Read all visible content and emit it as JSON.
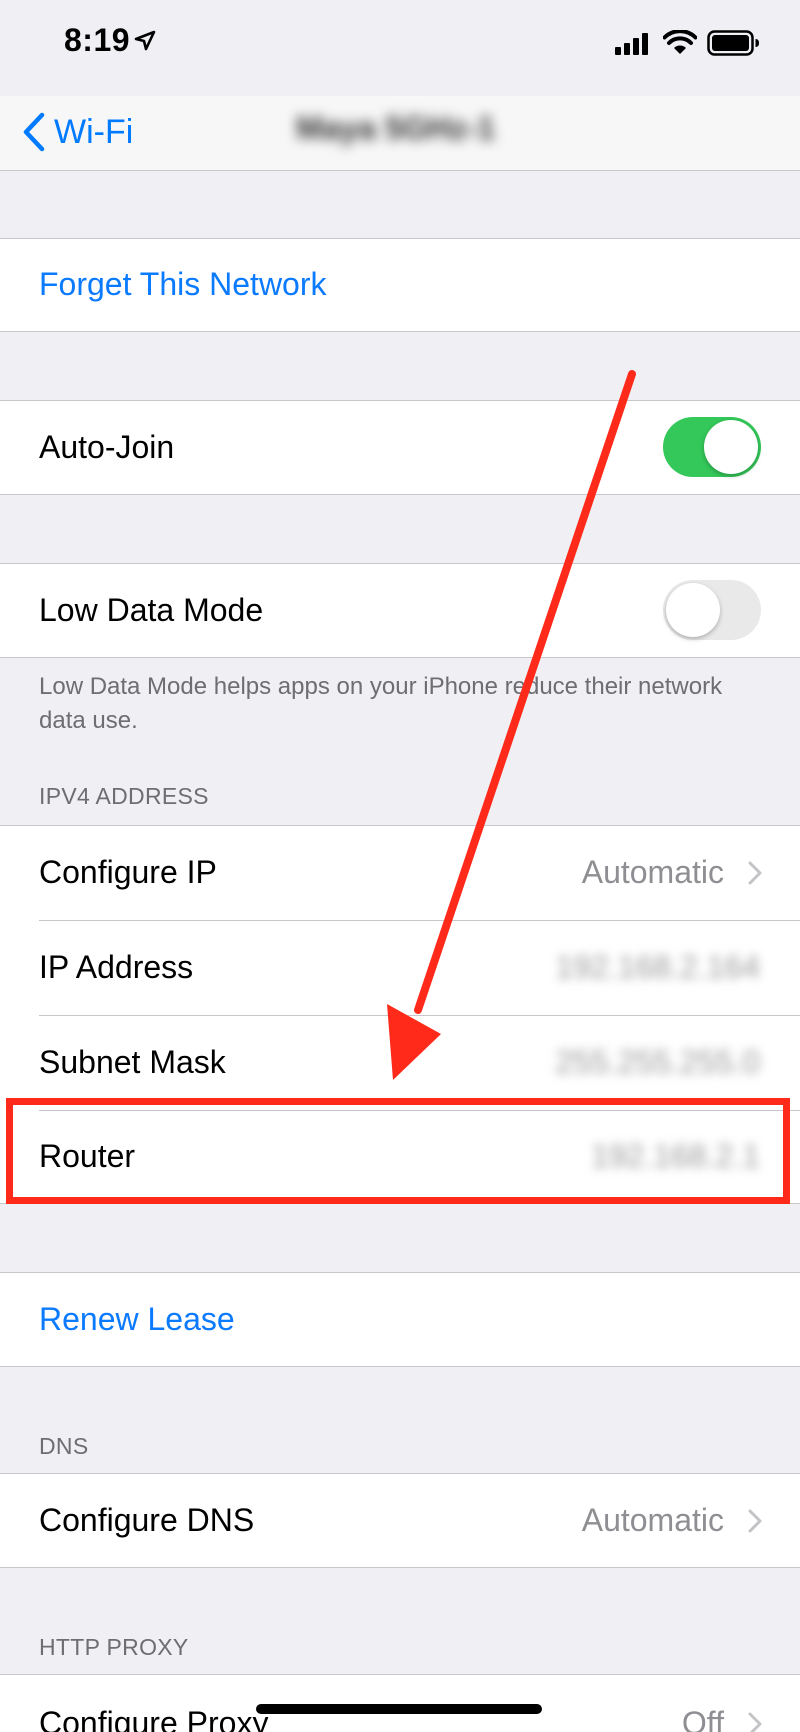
{
  "status_bar": {
    "time": "8:19"
  },
  "nav": {
    "back_label": "Wi-Fi",
    "title": "Maya 5GHz-1"
  },
  "forget_network": {
    "label": "Forget This Network"
  },
  "auto_join": {
    "label": "Auto-Join",
    "enabled": true
  },
  "low_data_mode": {
    "label": "Low Data Mode",
    "enabled": false,
    "footer": "Low Data Mode helps apps on your iPhone reduce their network data use."
  },
  "ipv4": {
    "header": "IPV4 ADDRESS",
    "configure_ip": {
      "label": "Configure IP",
      "value": "Automatic"
    },
    "ip_address": {
      "label": "IP Address",
      "value": "192.168.2.164"
    },
    "subnet_mask": {
      "label": "Subnet Mask",
      "value": "255.255.255.0"
    },
    "router": {
      "label": "Router",
      "value": "192.168.2.1"
    }
  },
  "renew_lease": {
    "label": "Renew Lease"
  },
  "dns": {
    "header": "DNS",
    "configure_dns": {
      "label": "Configure DNS",
      "value": "Automatic"
    }
  },
  "http_proxy": {
    "header": "HTTP PROXY",
    "configure_proxy": {
      "label": "Configure Proxy",
      "value": "Off"
    }
  },
  "colors": {
    "accent": "#007aff",
    "toggle_on": "#34c759",
    "annotation": "#ff2a1a"
  }
}
